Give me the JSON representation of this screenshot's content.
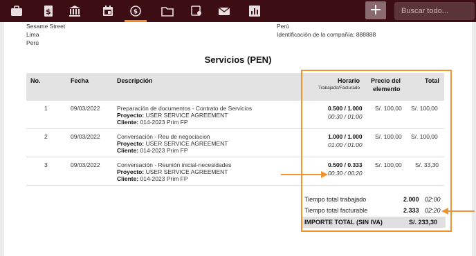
{
  "topbar": {
    "icons": [
      "briefcase-icon",
      "dollar-document-icon",
      "bank-icon",
      "calendar-icon",
      "time-money-icon",
      "folder-icon",
      "certificate-icon",
      "mail-icon",
      "chart-icon"
    ],
    "active_icon": "time-money-icon",
    "add_label": "+",
    "search_placeholder": "Buscar todo..."
  },
  "address_left": [
    "Sesame Street",
    "Lima",
    "Perú"
  ],
  "address_right": [
    "Perú",
    "Identificación de la compañía: 888888"
  ],
  "section_title": "Servicios (PEN)",
  "table": {
    "headers": {
      "no": "No.",
      "fecha": "Fecha",
      "descripcion": "Descripción",
      "horario": "Horario",
      "horario_sub": "Trabajado/Facturado",
      "precio_1": "Precio del",
      "precio_2": "elemento",
      "total": "Total"
    },
    "rows": [
      {
        "no": "1",
        "fecha": "09/03/2022",
        "desc": "Preparación de documentos - Contrato de Servicios",
        "proyecto_label": "Proyecto:",
        "proyecto": "USER SERVICE AGREEMENT",
        "cliente_label": "Cliente:",
        "cliente": "014-2023  Prim FP",
        "horas": "0.500 /  1.000",
        "tiempo": "00:30 /  01:00",
        "precio": "S/. 100,00",
        "total": "S/. 100,00"
      },
      {
        "no": "2",
        "fecha": "09/03/2022",
        "desc": "Conversación - Reu de negociacion",
        "proyecto_label": "Proyecto:",
        "proyecto": "USER SERVICE AGREEMENT",
        "cliente_label": "Cliente:",
        "cliente": "014-2023  Prim FP",
        "horas": "1.000 /  1.000",
        "tiempo": "01:00 /  01:00",
        "precio": "S/. 100,00",
        "total": "S/. 100,00"
      },
      {
        "no": "3",
        "fecha": "09/03/2022",
        "desc": "Conversación - Reunión inicial-necesidades",
        "proyecto_label": "Proyecto:",
        "proyecto": "USER SERVICE AGREEMENT",
        "cliente_label": "Cliente:",
        "cliente": "014-2023  Prim FP",
        "horas": "0.500 /  0.333",
        "tiempo": "00:30 /  00:20",
        "precio": "S/. 100,00",
        "total": "S/. 33,30"
      }
    ]
  },
  "totals": {
    "trabajado_label": "Tiempo total trabajado",
    "trabajado_horas": "2.000",
    "trabajado_tiempo": "02:00",
    "facturable_label": "Tiempo total facturable",
    "facturable_horas": "2.333",
    "facturable_tiempo": "02:20",
    "importe_label": "IMPORTE TOTAL (SIN IVA)",
    "importe_value": "S/. 233,30"
  },
  "colors": {
    "topbar": "#3d0d14",
    "accent_orange": "#f0922e",
    "header_gray": "#e3e3e3"
  }
}
